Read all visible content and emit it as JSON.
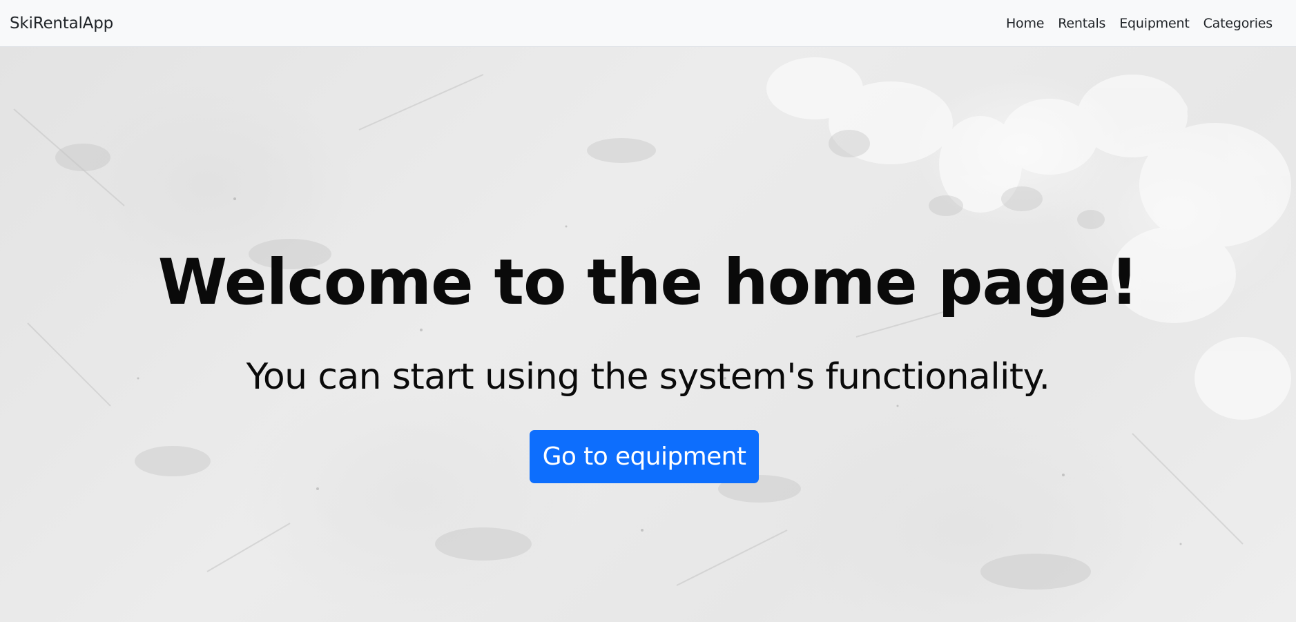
{
  "navbar": {
    "brand": "SkiRentalApp",
    "links": [
      "Home",
      "Rentals",
      "Equipment",
      "Categories"
    ]
  },
  "hero": {
    "title": "Welcome to the home page!",
    "subtitle": "You can start using the system's functionality.",
    "button_label": "Go to equipment",
    "background_description": "snow-texture",
    "button_color": "#0d6efd"
  }
}
